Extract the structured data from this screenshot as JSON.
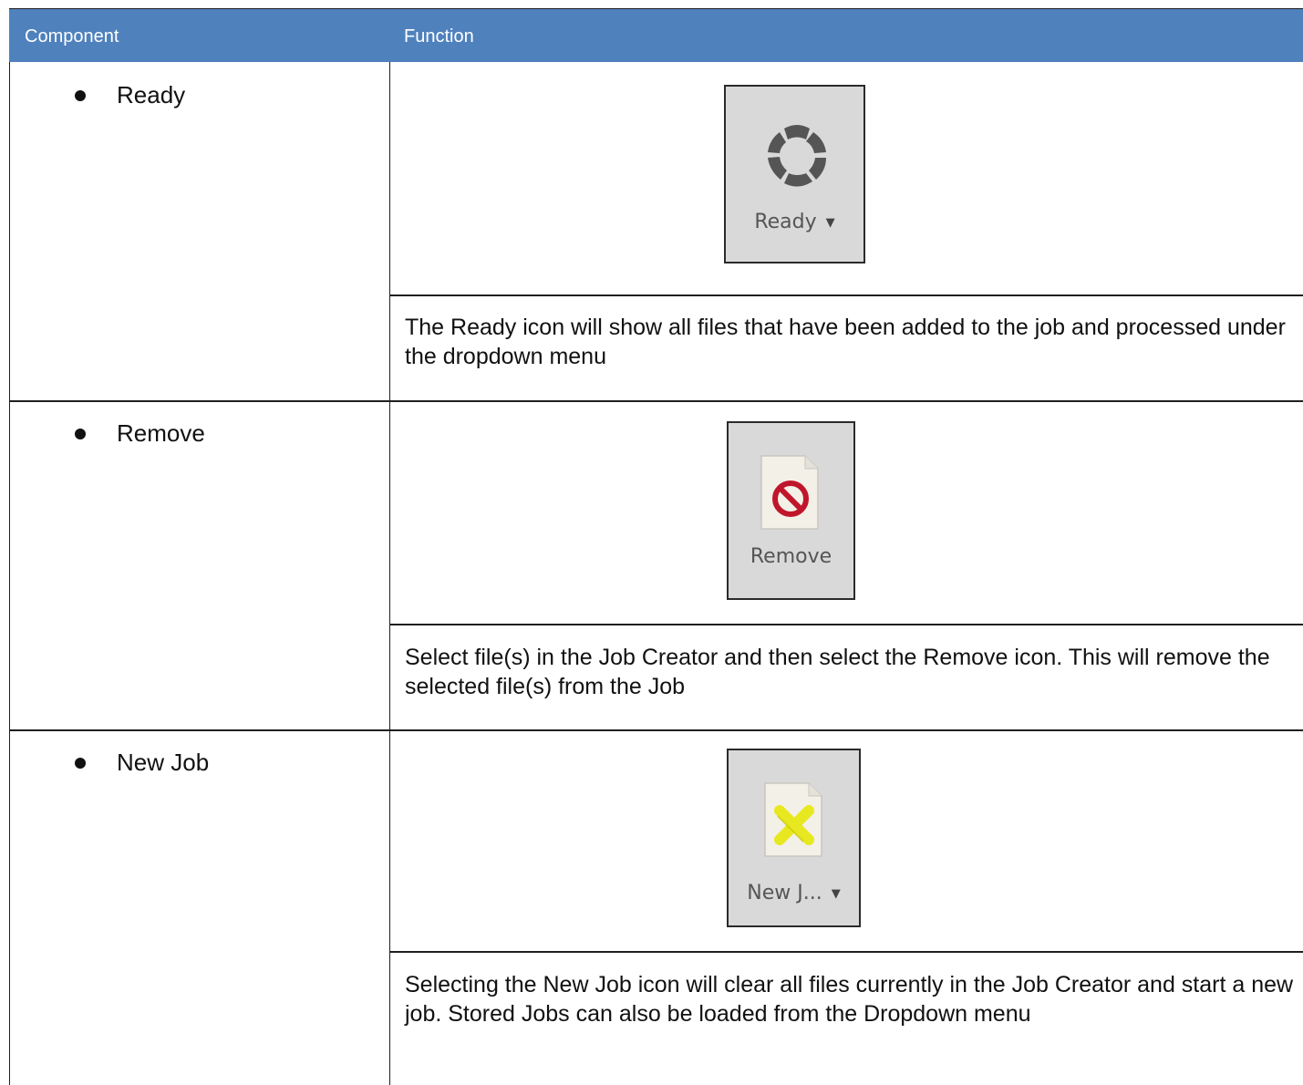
{
  "table": {
    "header": {
      "component": "Component",
      "function": "Function"
    },
    "rows": [
      {
        "component": "Ready",
        "icon": {
          "name": "ready-spinner-icon",
          "caption": "Ready",
          "has_dropdown": true
        },
        "description": "The Ready icon will show all files that have been added to the job and processed under the dropdown menu"
      },
      {
        "component": "Remove",
        "icon": {
          "name": "remove-file-icon",
          "caption": "Remove",
          "has_dropdown": false
        },
        "description": "Select file(s) in the Job Creator and then select the Remove icon. This will remove the selected file(s) from the Job"
      },
      {
        "component": "New Job",
        "icon": {
          "name": "new-job-file-icon",
          "caption": "New J...",
          "has_dropdown": true
        },
        "description": "Selecting the New Job icon will clear all files currently in the Job Creator and start a new job. Stored Jobs can also be loaded from the Dropdown menu"
      }
    ]
  },
  "colors": {
    "header_bg": "#4f81bd",
    "header_text": "#ffffff",
    "icon_bg": "#d9d9d9",
    "prohibit_red": "#c0162b",
    "new_job_yellow": "#e8e821"
  },
  "icons": {
    "dropdown_caret": "▼"
  }
}
